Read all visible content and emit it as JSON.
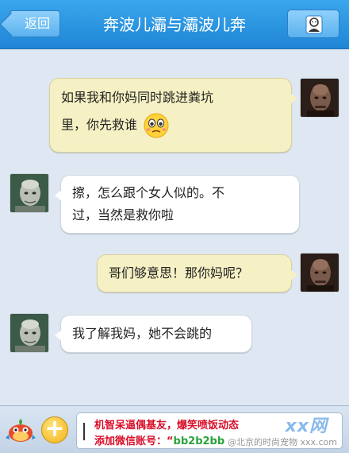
{
  "header": {
    "back_label": "返回",
    "title": "奔波儿灞与灞波儿奔"
  },
  "messages": [
    {
      "side": "out",
      "lines": [
        "如果我和你妈同时跳进粪坑",
        "里，你先救谁"
      ],
      "emoji": "worried-face-emoji"
    },
    {
      "side": "in",
      "lines": [
        "擦，怎么跟个女人似的。不",
        "过，当然是救你啦"
      ]
    },
    {
      "side": "out",
      "lines": [
        "哥们够意思！那你妈呢？"
      ]
    },
    {
      "side": "in",
      "lines": [
        "我了解我妈，她不会跳的"
      ]
    }
  ],
  "bottom": {
    "ad_line1": "机智呆逼偶基友，爆笑喷饭动态",
    "ad_line2_prefix": "添加微信账号：“",
    "ad_line2_code": "bb2b2bb",
    "watermark": "xx网",
    "watermark_sub": "@北京的时尚宠物 xxx.com"
  },
  "colors": {
    "header": "#2393e0",
    "bubble_out": "#f6f1c4",
    "bubble_in": "#ffffff",
    "background": "#dfe8f2",
    "ad_text": "#d8102a"
  }
}
